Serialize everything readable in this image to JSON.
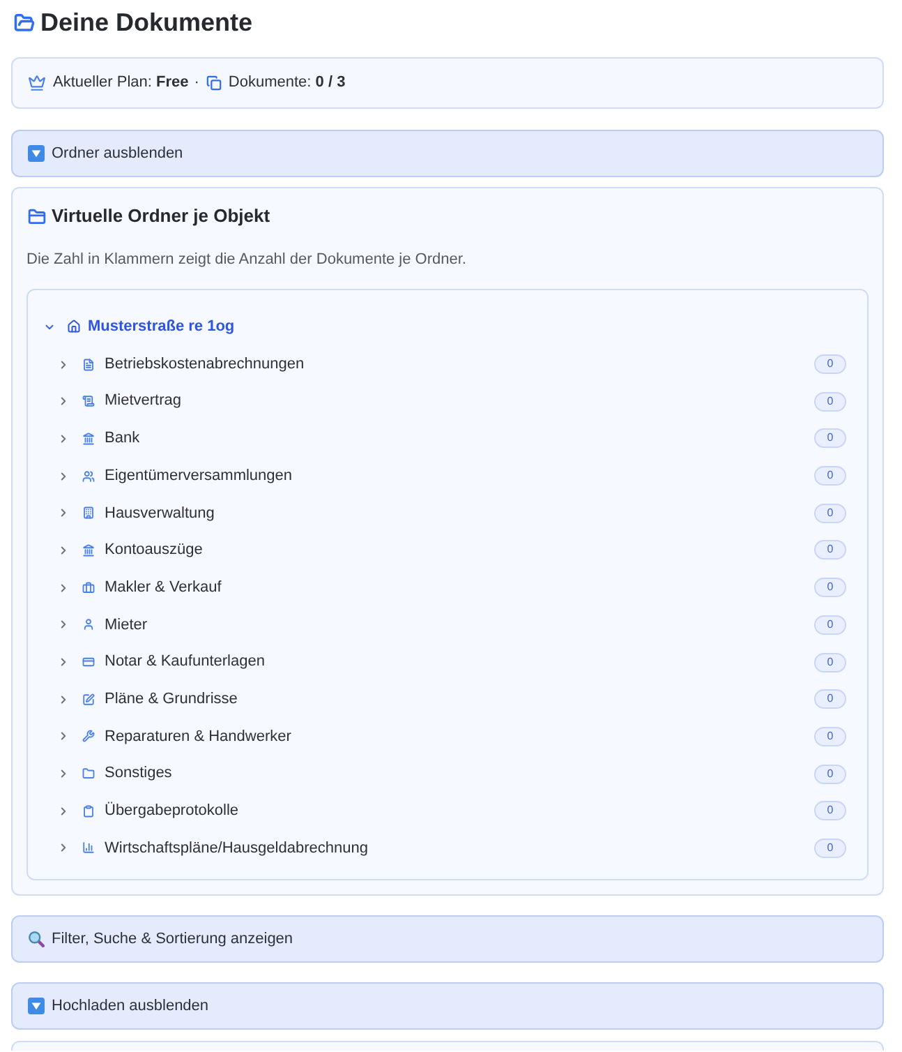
{
  "page_title": "Deine Dokumente",
  "plan_bar": {
    "plan_text": "Aktueller Plan: **Free**",
    "separator": "·",
    "documents_text": "Dokumente: **0 / 3**"
  },
  "folders_toggle": {
    "label": "Ordner ausblenden"
  },
  "folders_panel": {
    "title": "Virtuelle Ordner je Objekt",
    "description": "Die Zahl in Klammern zeigt die Anzahl der Dokumente je Ordner.",
    "tree": [
      {
        "label": "Musterstraße re 1og",
        "expanded": true,
        "children": [
          {
            "label": "Betriebskostenabrechnungen",
            "count": "0",
            "expanded": false
          },
          {
            "label": "Mietvertrag",
            "count": "0",
            "expanded": false
          },
          {
            "label": "Bank",
            "count": "0",
            "expanded": false
          },
          {
            "label": "Eigentümerversammlungen",
            "count": "0",
            "expanded": false
          },
          {
            "label": "Hausverwaltung",
            "count": "0",
            "expanded": false
          },
          {
            "label": "Kontoauszüge",
            "count": "0",
            "expanded": false
          },
          {
            "label": "Makler & Verkauf",
            "count": "0",
            "expanded": false
          },
          {
            "label": "Mieter",
            "count": "0",
            "expanded": false
          },
          {
            "label": "Notar & Kaufunterlagen",
            "count": "0",
            "expanded": false
          },
          {
            "label": "Pläne & Grundrisse",
            "count": "0",
            "expanded": false
          },
          {
            "label": "Reparaturen & Handwerker",
            "count": "0",
            "expanded": false
          },
          {
            "label": "Sonstiges",
            "count": "0",
            "expanded": false
          },
          {
            "label": "Übergabeprotokolle",
            "count": "0",
            "expanded": false
          },
          {
            "label": "Wirtschaftspläne/Hausgeldabrechnung",
            "count": "0",
            "expanded": false
          }
        ]
      }
    ]
  },
  "filter_toggle": {
    "label": "Filter, Suche & Sortierung anzeigen"
  },
  "upload_toggle": {
    "label": "Hochladen ausblenden"
  }
}
